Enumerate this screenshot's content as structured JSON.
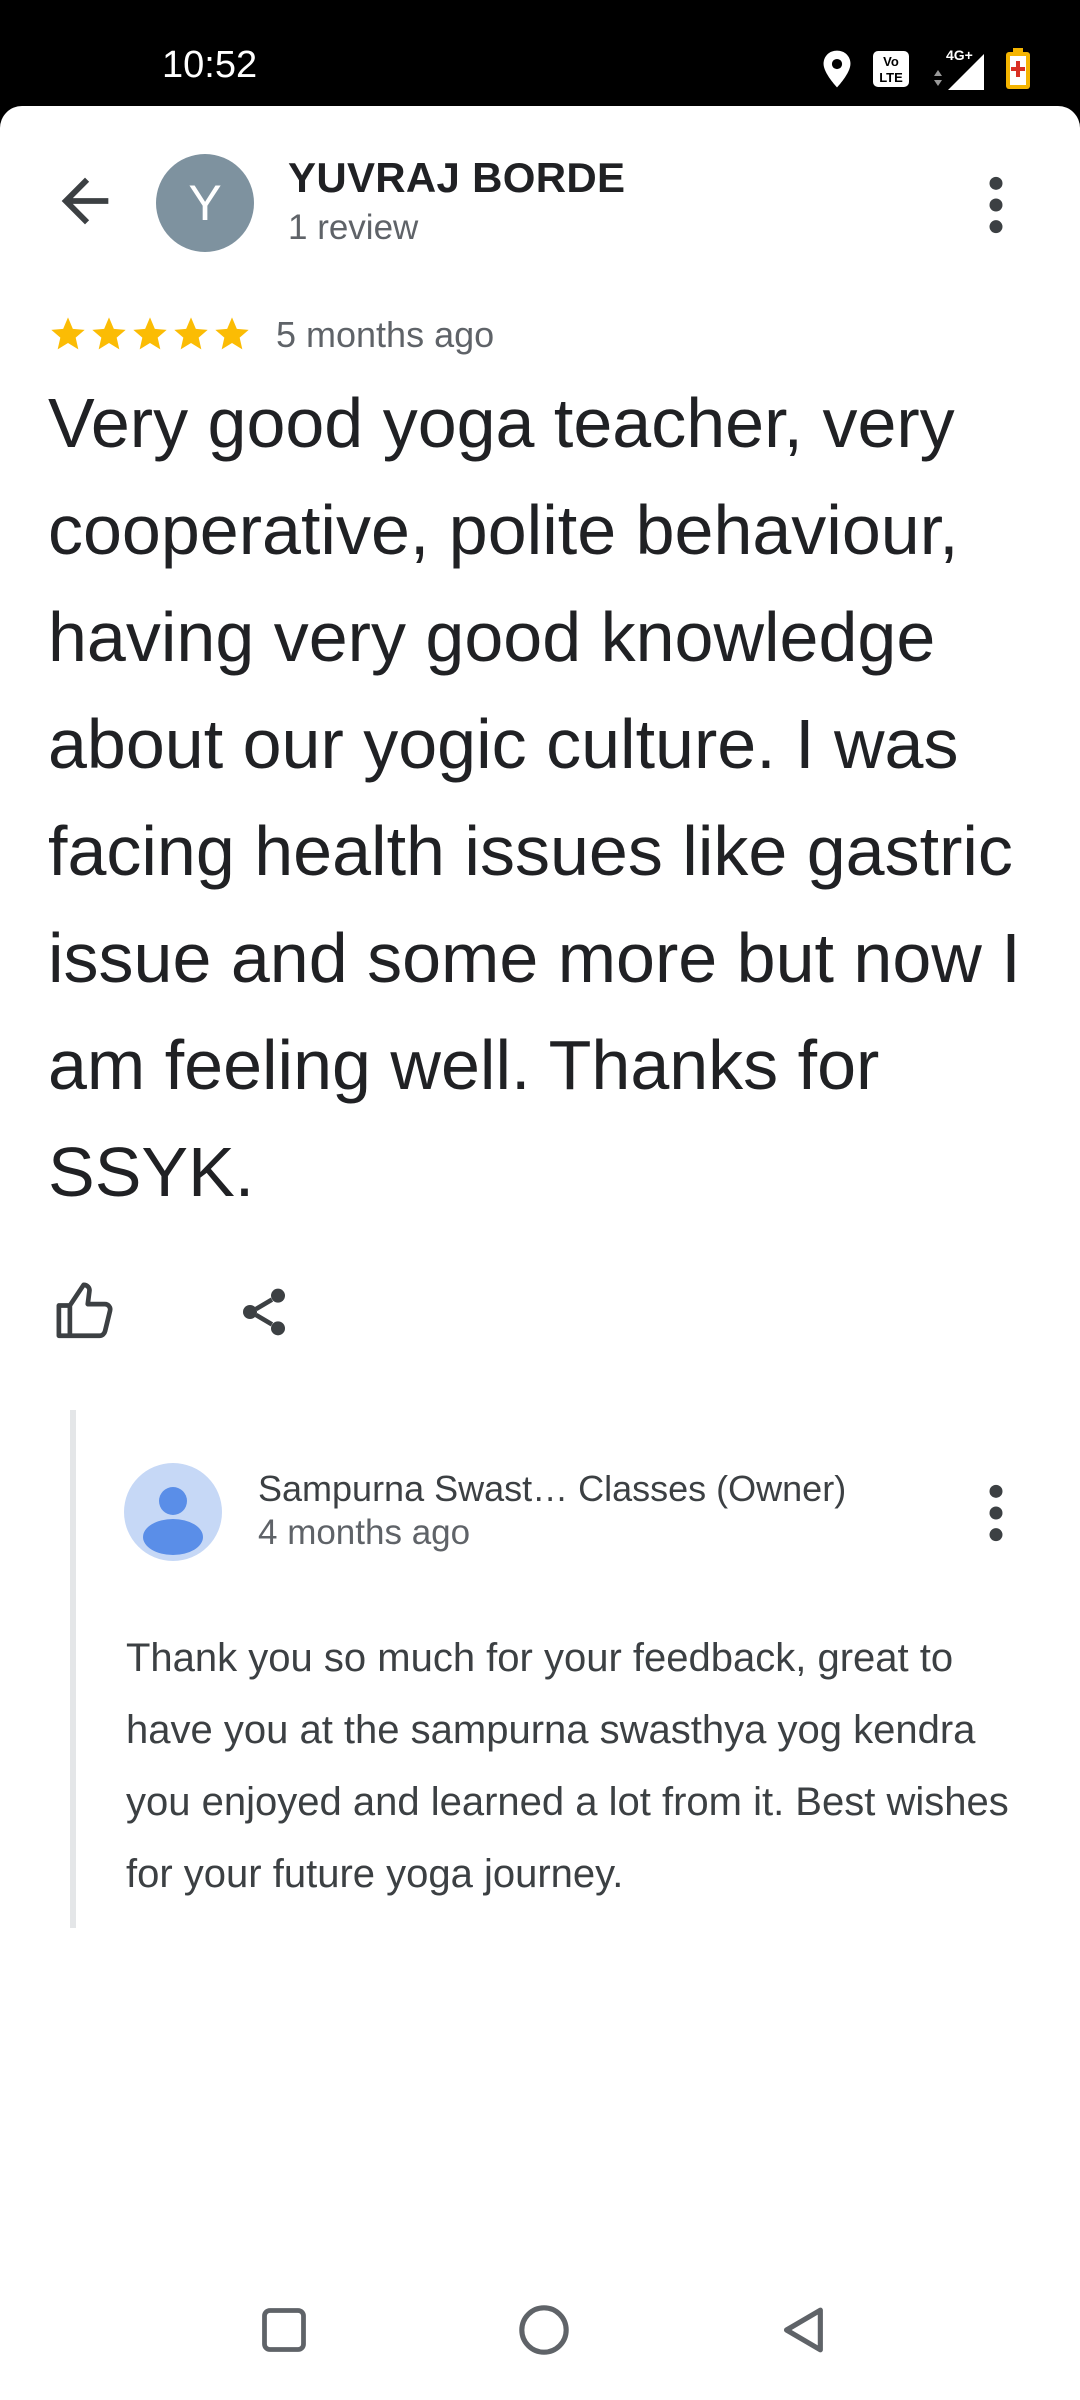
{
  "status_bar": {
    "time": "10:52",
    "icons": [
      "location-icon",
      "volte-icon",
      "4g-signal-icon",
      "battery-saver-icon"
    ]
  },
  "reviewer": {
    "avatar_initial": "Y",
    "name": "YUVRAJ BORDE",
    "review_count": "1 review",
    "rating": 5,
    "time": "5 months ago",
    "text": "Very good yoga teacher, very cooperative, polite behaviour, having very good knowledge about our yogic culture. I was facing health issues like gastric issue and some more but now I am feeling well. Thanks for SSYK."
  },
  "owner_reply": {
    "name": "Sampurna Swast…  Classes (Owner)",
    "time": "4 months ago",
    "text": "Thank you so much for your feedback, great to have you at the sampurna swasthya yog kendra you enjoyed and learned a lot from it. Best wishes for your future yoga journey."
  },
  "colors": {
    "star": "#fbbc04",
    "avatar_bg": "#7e929f",
    "owner_avatar_bg": "#c6d8f6",
    "owner_avatar_fg": "#5a8ee8"
  }
}
